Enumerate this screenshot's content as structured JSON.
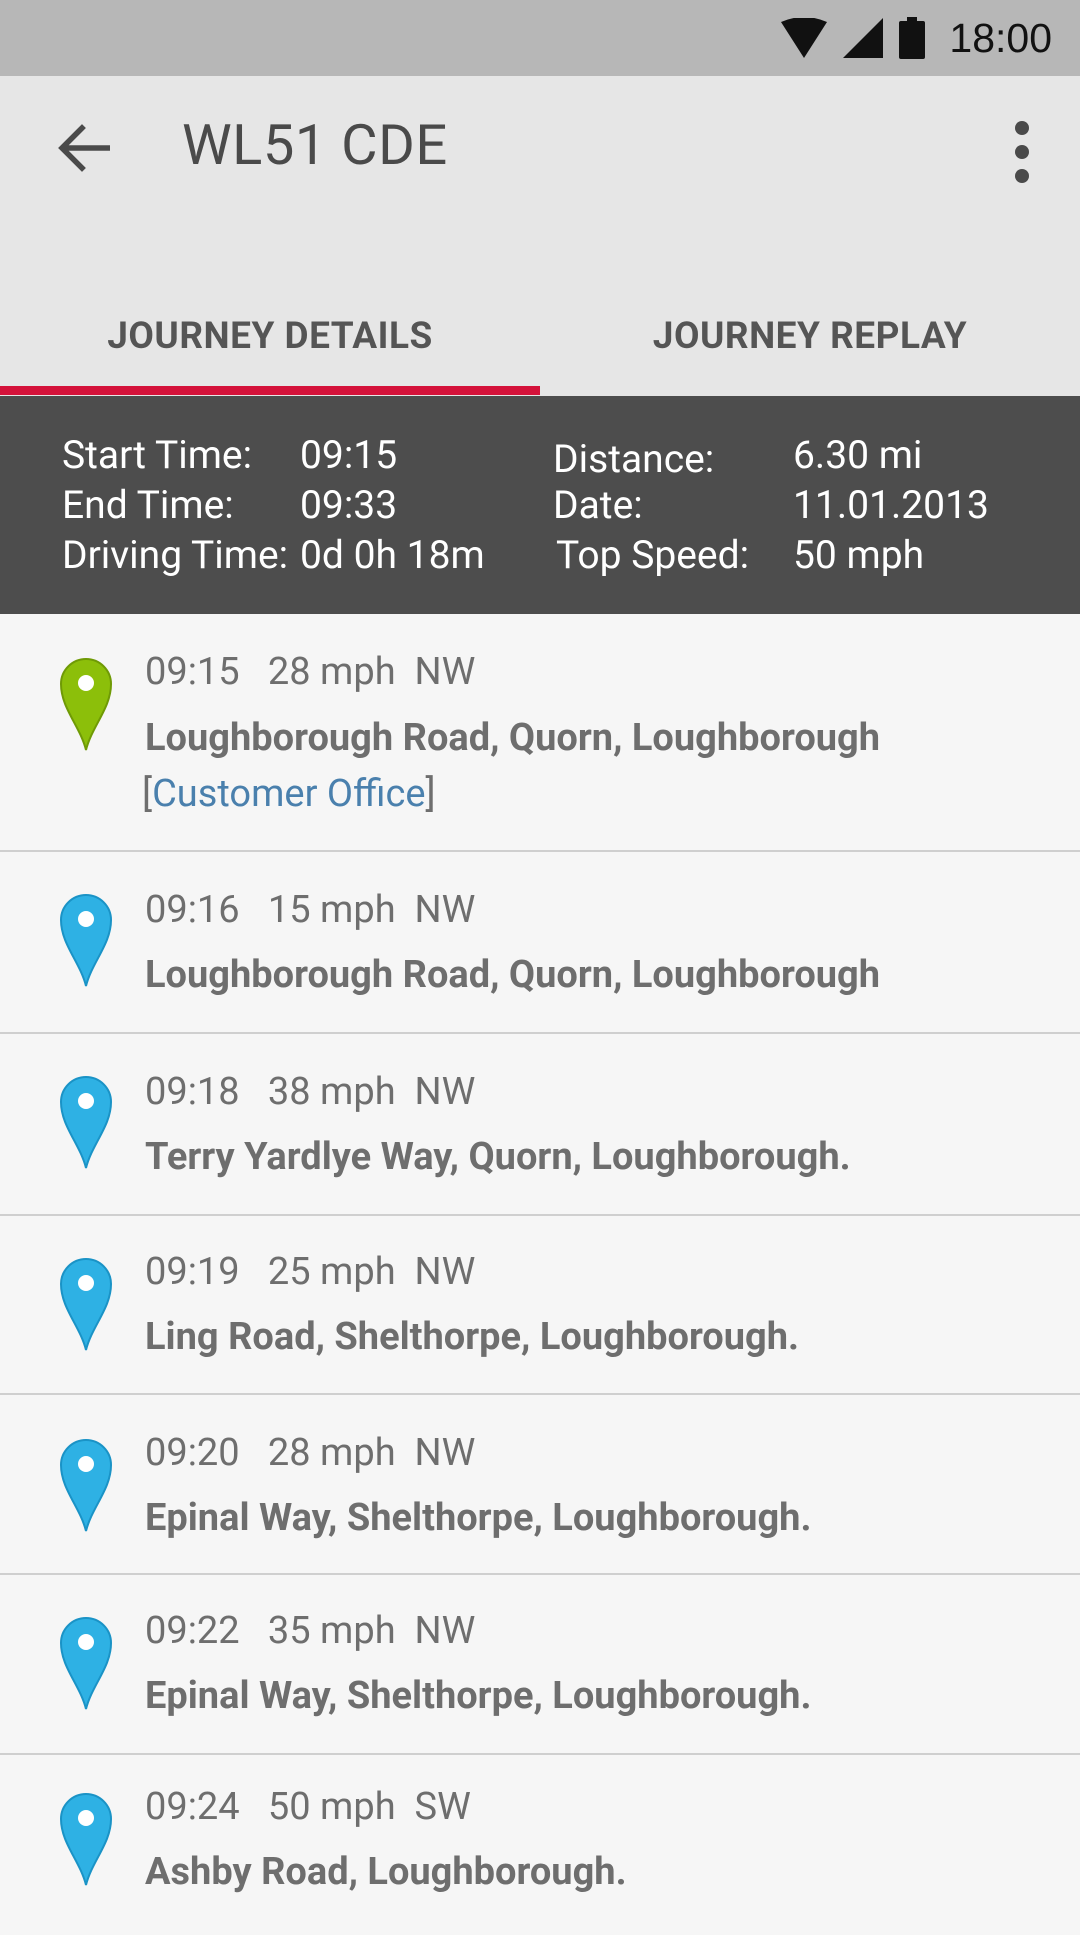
{
  "status_bar": {
    "time": "18:00",
    "icons": [
      "wifi-icon",
      "signal-icon",
      "battery-icon"
    ]
  },
  "app_bar": {
    "title": "WL51 CDE",
    "back_icon": "arrow-back-icon",
    "menu_icon": "more-vert-icon"
  },
  "tabs": [
    {
      "label": "JOURNEY DETAILS",
      "selected": true
    },
    {
      "label": "JOURNEY REPLAY",
      "selected": false
    }
  ],
  "colors": {
    "accent": "#d4123a",
    "start_pin": "#8cbf0a",
    "waypoint_pin": "#2eb1e4",
    "link": "#4a80ad",
    "summary_bg": "#4d4d4d"
  },
  "summary": {
    "start_time_label": "Start Time:",
    "start_time": "09:15",
    "end_time_label": "End Time:",
    "end_time": "09:33",
    "driving_time_label": "Driving Time:",
    "driving_time": "0d 0h 18m",
    "distance_label": "Distance:",
    "distance": "6.30 mi",
    "date_label": "Date:",
    "date": "11.01.2013",
    "top_speed_label": "Top Speed:",
    "top_speed": "50 mph"
  },
  "journey_points": [
    {
      "time": "09:15",
      "speed": "28 mph",
      "direction": "NW",
      "address": "Loughborough Road, Quorn, Loughborough",
      "tag": "Customer Office",
      "pin": "start"
    },
    {
      "time": "09:16",
      "speed": "15 mph",
      "direction": "NW",
      "address": "Loughborough Road, Quorn, Loughborough",
      "pin": "waypoint"
    },
    {
      "time": "09:18",
      "speed": "38 mph",
      "direction": "NW",
      "address": "Terry Yardlye Way, Quorn, Loughborough.",
      "pin": "waypoint"
    },
    {
      "time": "09:19",
      "speed": "25 mph",
      "direction": "NW",
      "address": "Ling Road, Shelthorpe, Loughborough.",
      "pin": "waypoint"
    },
    {
      "time": "09:20",
      "speed": "28 mph",
      "direction": "NW",
      "address": "Epinal Way, Shelthorpe, Loughborough.",
      "pin": "waypoint"
    },
    {
      "time": "09:22",
      "speed": "35 mph",
      "direction": "NW",
      "address": "Epinal Way, Shelthorpe, Loughborough.",
      "pin": "waypoint"
    },
    {
      "time": "09:24",
      "speed": "50 mph",
      "direction": "SW",
      "address": "Ashby Road, Loughborough.",
      "pin": "waypoint"
    }
  ]
}
